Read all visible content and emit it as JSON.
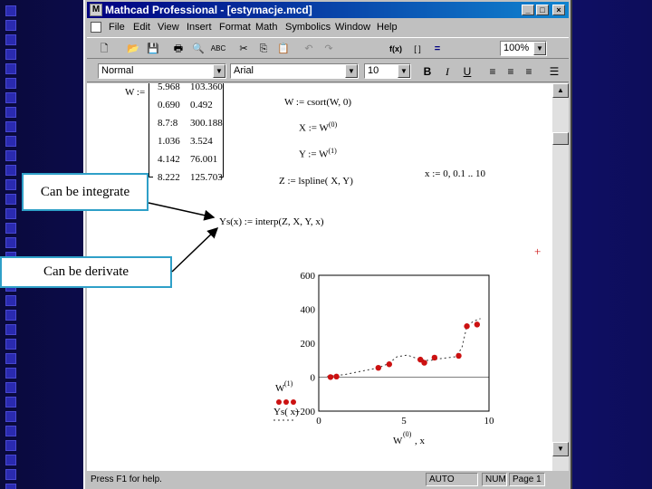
{
  "window": {
    "title": "Mathcad Professional - [estymacje.mcd]",
    "icons": {
      "app": "mathcad-icon",
      "minimize": "minimize-icon",
      "maximize": "maximize-icon",
      "close": "close-icon"
    },
    "min_glyph": "_",
    "max_glyph": "□",
    "close_glyph": "×"
  },
  "menu": [
    "File",
    "Edit",
    "View",
    "Insert",
    "Format",
    "Math",
    "Symbolics",
    "Window",
    "Help"
  ],
  "toolbar": {
    "zoom": "100%",
    "glyphs": {
      "new": "🗋",
      "open": "📂",
      "save": "💾",
      "print": "🖶",
      "preview": "🔍",
      "spell": "ABC",
      "cut": "✂",
      "copy": "⎘",
      "paste": "📋",
      "undo": "↶",
      "redo": "↷",
      "insert_function": "f(x)",
      "insert_unit": "[ ]",
      "calculate": "="
    }
  },
  "format": {
    "style": "Normal",
    "font": "Arial",
    "size": "10",
    "bold": "B",
    "italic": "I",
    "underline": "U",
    "align_icons": [
      "align-left-icon",
      "align-center-icon",
      "align-right-icon",
      "bullets-icon"
    ]
  },
  "worksheet": {
    "matrix_label": "W :=",
    "matrix_rows": [
      [
        "5.968",
        "103.360"
      ],
      [
        "0.690",
        "0.492"
      ],
      [
        "8.7:8",
        "300.188"
      ],
      [
        "1.036",
        "3.524"
      ],
      [
        "4.142",
        "76.001"
      ],
      [
        "8.222",
        "125.703"
      ]
    ],
    "sort_expr": "W := csort(W, 0)",
    "x_expr": "X := W",
    "x_sup": "(0)",
    "y_expr": "Y := W",
    "y_sup": "(1)",
    "spline_expr": "Z := lspline( X, Y)",
    "range_expr": "x := 0, 0.1 .. 10",
    "interp_expr": "Ys(x) := interp(Z, X, Y, x)",
    "plus_marker": "+"
  },
  "callouts": {
    "integrate": "Can be integrate",
    "derivate": "Can be derivate"
  },
  "chart_data": {
    "type": "scatter",
    "ylim": [
      -200,
      600
    ],
    "xlim": [
      0,
      10
    ],
    "y_ticks": [
      "600",
      "400",
      "200",
      "0",
      "−200"
    ],
    "x_ticks": [
      "0",
      "5",
      "10"
    ],
    "ylabel_top": "W",
    "ylabel_top_sup": "(1)",
    "ylabel_bottom": "Ys( x)",
    "xlabel": "W",
    "xlabel_sup": "(0)",
    "xlabel_suffix": ", x",
    "points": [
      [
        0.69,
        0.49
      ],
      [
        1.04,
        3.52
      ],
      [
        3.5,
        55
      ],
      [
        4.14,
        76
      ],
      [
        5.97,
        103.4
      ],
      [
        6.2,
        85
      ],
      [
        6.8,
        115
      ],
      [
        8.22,
        125.7
      ],
      [
        8.7,
        300.2
      ],
      [
        9.3,
        310
      ]
    ],
    "spline": [
      [
        0.5,
        5
      ],
      [
        1.5,
        15
      ],
      [
        2.5,
        35
      ],
      [
        3.5,
        55
      ],
      [
        4.1,
        80
      ],
      [
        4.6,
        120
      ],
      [
        5.2,
        130
      ],
      [
        5.97,
        103
      ],
      [
        6.5,
        98
      ],
      [
        7.2,
        110
      ],
      [
        8.0,
        120
      ],
      [
        8.4,
        170
      ],
      [
        8.7,
        300
      ],
      [
        9.1,
        330
      ],
      [
        9.5,
        345
      ]
    ],
    "point_color": "#cc1111"
  },
  "status": {
    "help": "Press F1 for help.",
    "mode": "AUTO",
    "num": "NUM",
    "page": "Page 1"
  },
  "scroll": {
    "up_glyph": "▲",
    "down_glyph": "▼"
  }
}
